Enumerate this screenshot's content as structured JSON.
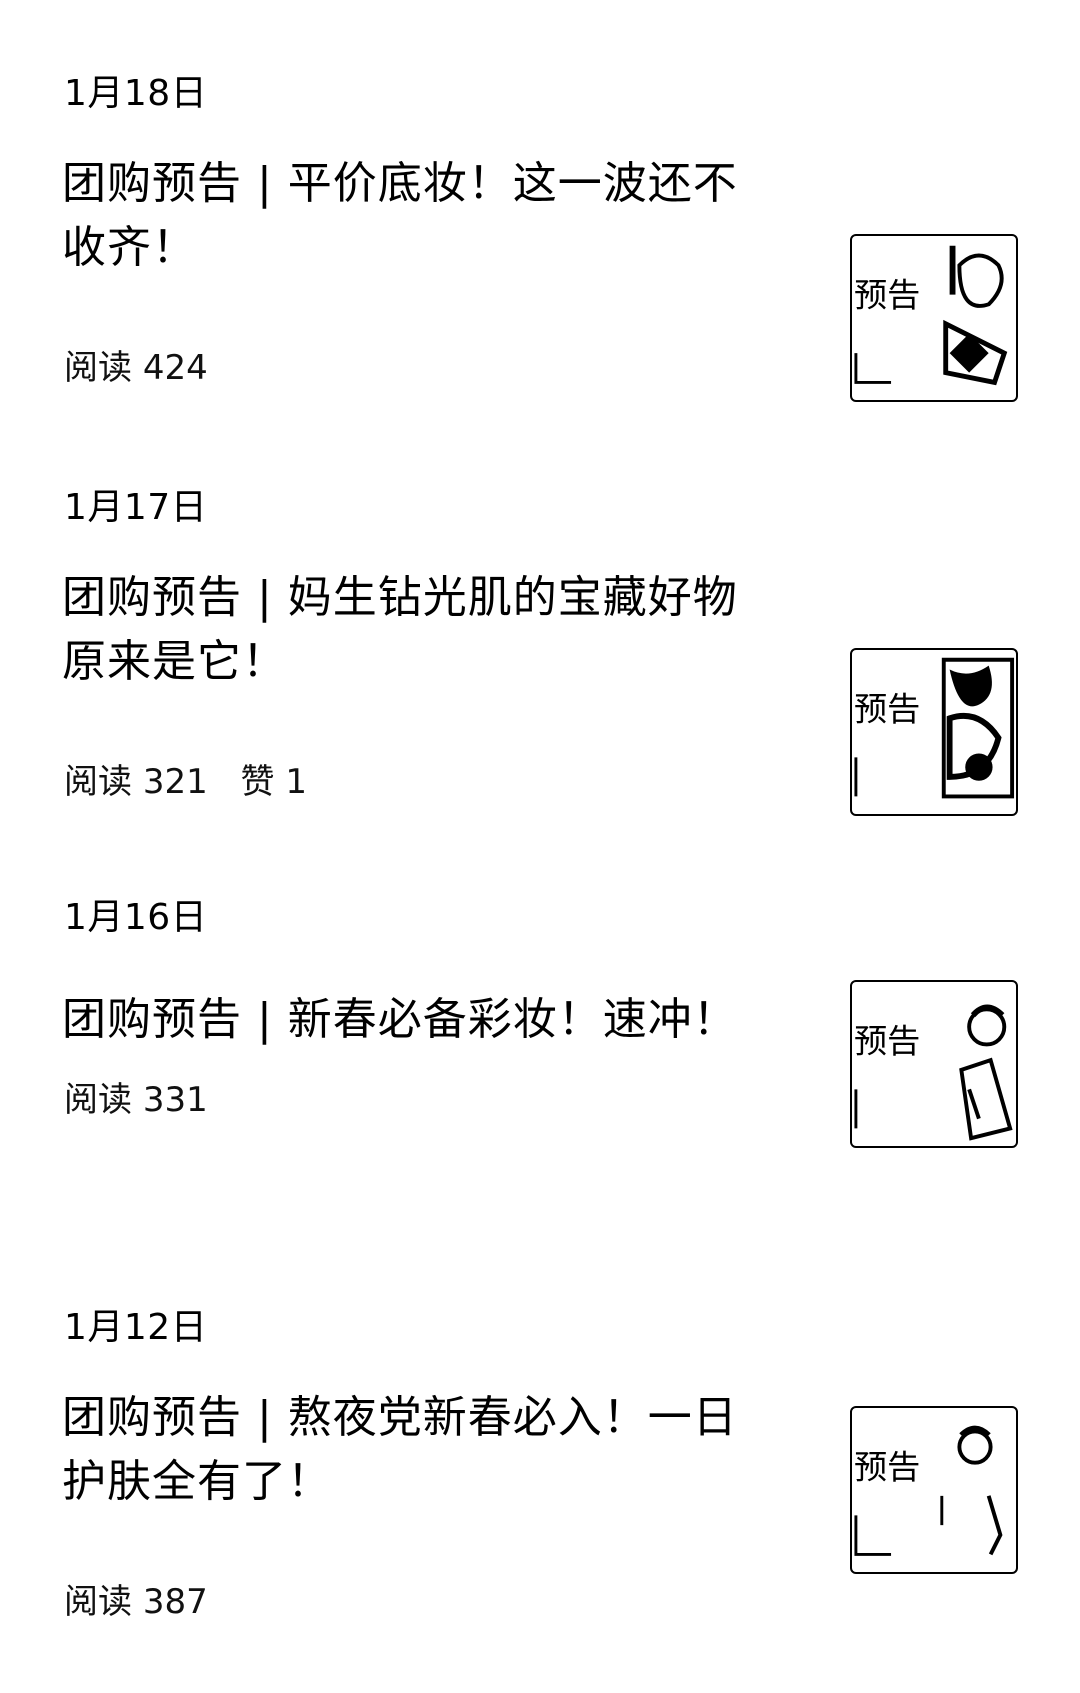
{
  "groups": [
    {
      "date": "1月18日",
      "article": {
        "title": "团购预告 | 平价底妆！这一波还不收齐！",
        "read_label": "阅读",
        "reads": "424",
        "likes": "",
        "thumb_icon": "group-buy-thumbnail-icon",
        "thumb_text": "预告"
      }
    },
    {
      "date": "1月17日",
      "article": {
        "title": "团购预告 | 妈生钻光肌的宝藏好物原来是它！",
        "read_label": "阅读",
        "reads": "321",
        "likes": "赞 1",
        "thumb_icon": "group-buy-thumbnail-icon",
        "thumb_text": "预告"
      }
    },
    {
      "date": "1月16日",
      "article": {
        "title": "团购预告 | 新春必备彩妆！速冲！",
        "read_label": "阅读",
        "reads": "331",
        "likes": "",
        "thumb_icon": "group-buy-thumbnail-icon",
        "thumb_text": "预告"
      }
    },
    {
      "date": "1月12日",
      "article": {
        "title": "团购预告 | 熬夜党新春必入！一日护肤全有了！",
        "read_label": "阅读",
        "reads": "387",
        "likes": "",
        "thumb_icon": "group-buy-thumbnail-icon",
        "thumb_text": "预告"
      }
    }
  ]
}
